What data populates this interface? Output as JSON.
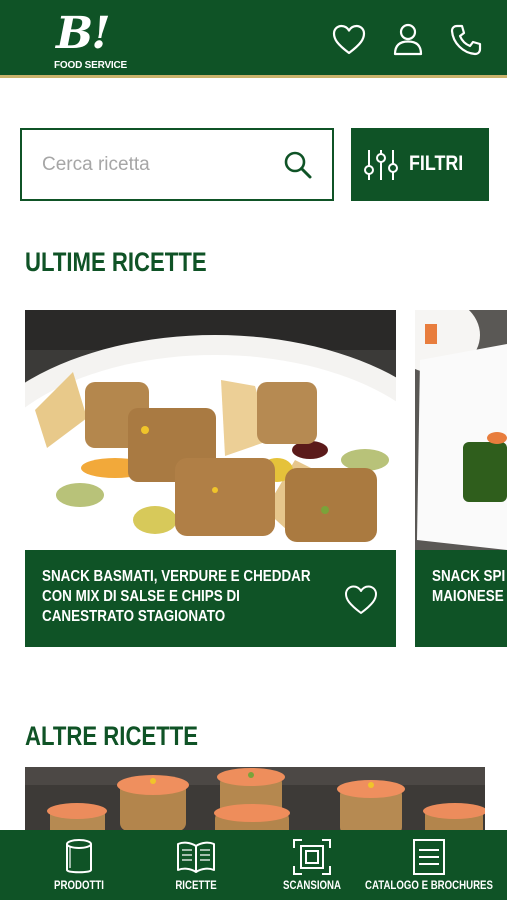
{
  "brand": {
    "logo_mark": "B!",
    "logo_sub": "FOOD SERVICE",
    "primary_color": "#0f5326",
    "accent_color": "#c9b26b"
  },
  "header": {
    "icons": [
      "heart-icon",
      "user-icon",
      "phone-icon"
    ]
  },
  "search": {
    "placeholder": "Cerca ricetta",
    "filter_label": "FILTRI"
  },
  "latest": {
    "title": "ULTIME RICETTE",
    "cards": [
      {
        "title": "SNACK BASMATI, VERDURE E CHEDDAR CON MIX DI SALSE E CHIPS DI CANESTRATO STAGIONATO"
      },
      {
        "title": "SNACK SPI MAIONESE"
      }
    ]
  },
  "others": {
    "title": "ALTRE RICETTE"
  },
  "bottom_nav": {
    "items": [
      {
        "label": "PRODOTTI",
        "icon": "can-icon"
      },
      {
        "label": "RICETTE",
        "icon": "book-icon"
      },
      {
        "label": "SCANSIONA",
        "icon": "scan-icon"
      },
      {
        "label": "CATALOGO E BROCHURES",
        "icon": "catalog-icon"
      }
    ]
  }
}
